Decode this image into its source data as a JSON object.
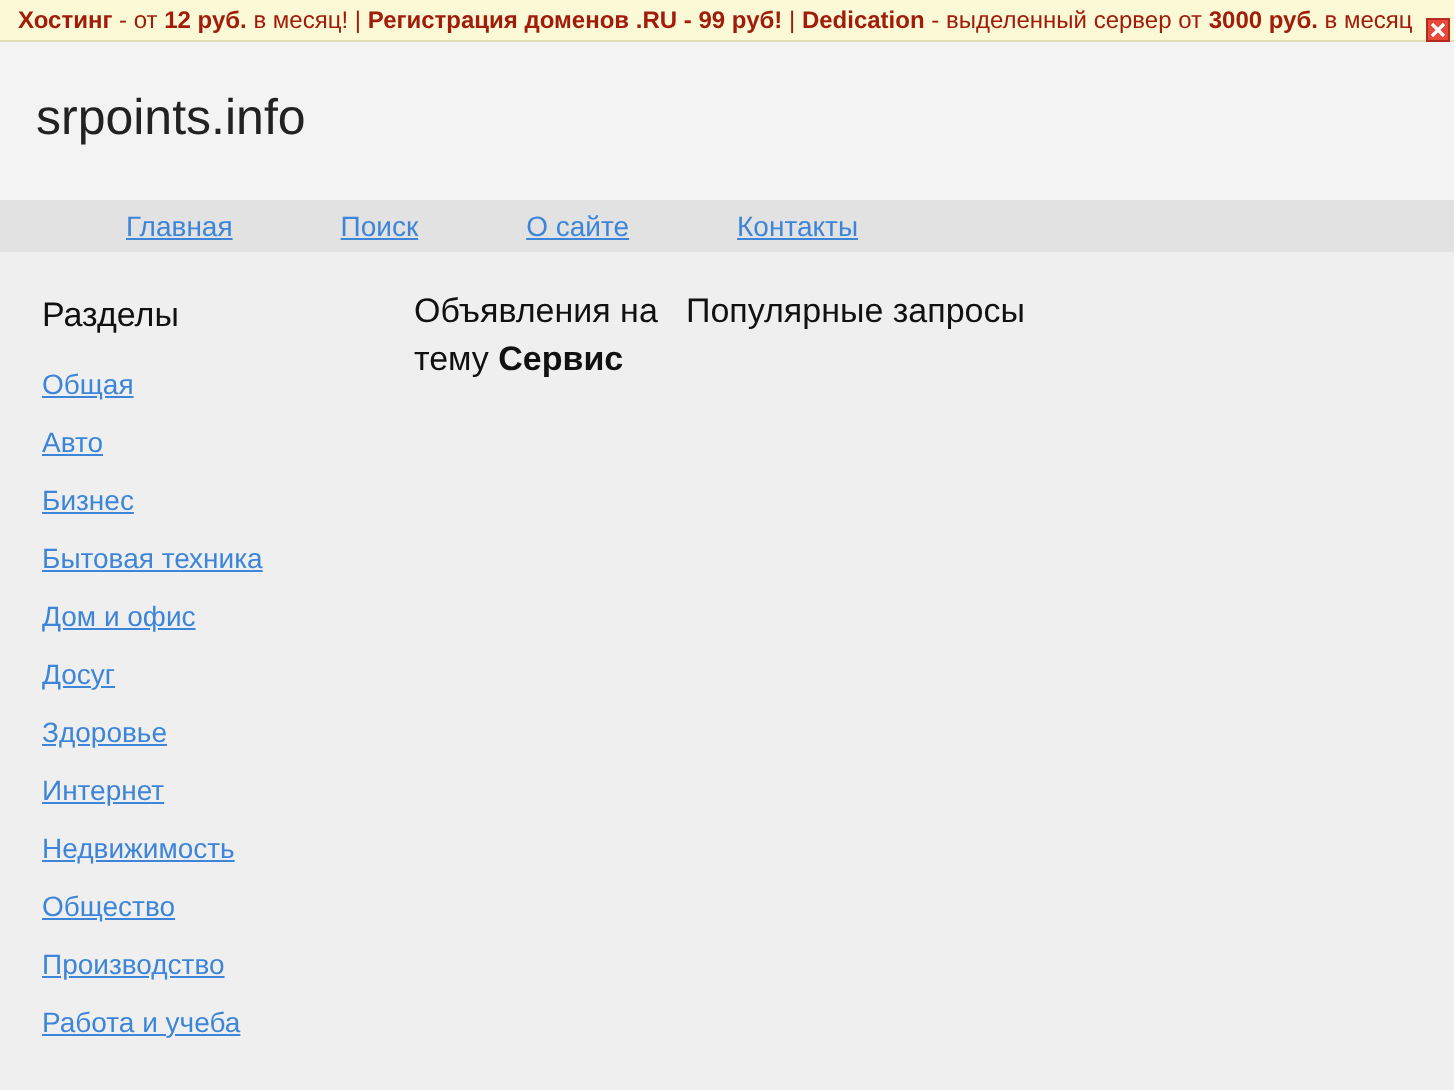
{
  "banner": {
    "text": "**Хостинг** - от **12 руб.** в месяц! | **Регистрация доменов .RU - 99 руб!** | **Dedication** - выделенный сервер от **3000 руб.** в месяц"
  },
  "site_title": "srpoints.info",
  "nav": [
    "Главная",
    "Поиск",
    "О сайте",
    "Контакты"
  ],
  "sidebar": {
    "heading": "Разделы",
    "items": [
      "Общая",
      "Авто",
      "Бизнес",
      "Бытовая техника",
      "Дом и офис",
      "Досуг",
      "Здоровье",
      "Интернет",
      "Недвижимость",
      "Общество",
      "Производство",
      "Работа и учеба"
    ]
  },
  "main": {
    "heading": "Объявления на тему **Сервис**",
    "popular": "Популярные запросы"
  }
}
